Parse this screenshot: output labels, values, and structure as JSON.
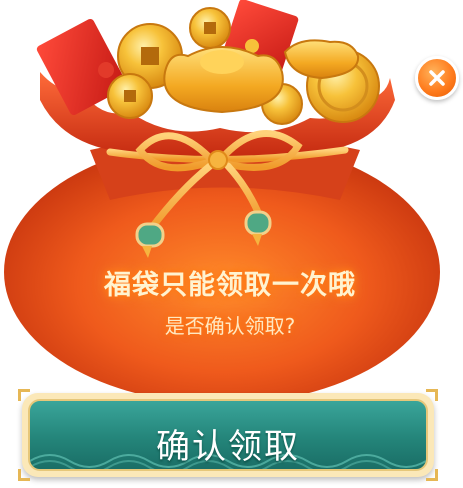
{
  "dialog": {
    "title": "福袋只能领取一次哦",
    "subtitle": "是否确认领取?",
    "confirm_label": "确认领取"
  },
  "icons": {
    "close": "close-icon",
    "bag": "lucky-bag-icon",
    "coin": "gold-coin-icon",
    "ingot": "gold-ingot-icon",
    "envelope": "red-envelope-icon"
  },
  "colors": {
    "bag_main": "#e8501a",
    "bag_dark": "#c4330e",
    "bow": "#f7b247",
    "coin": "#f6b526",
    "envelope": "#e0281f",
    "button_teal": "#2a9184",
    "button_gold": "#f2d08a",
    "close_orange": "#ff7d1f"
  }
}
